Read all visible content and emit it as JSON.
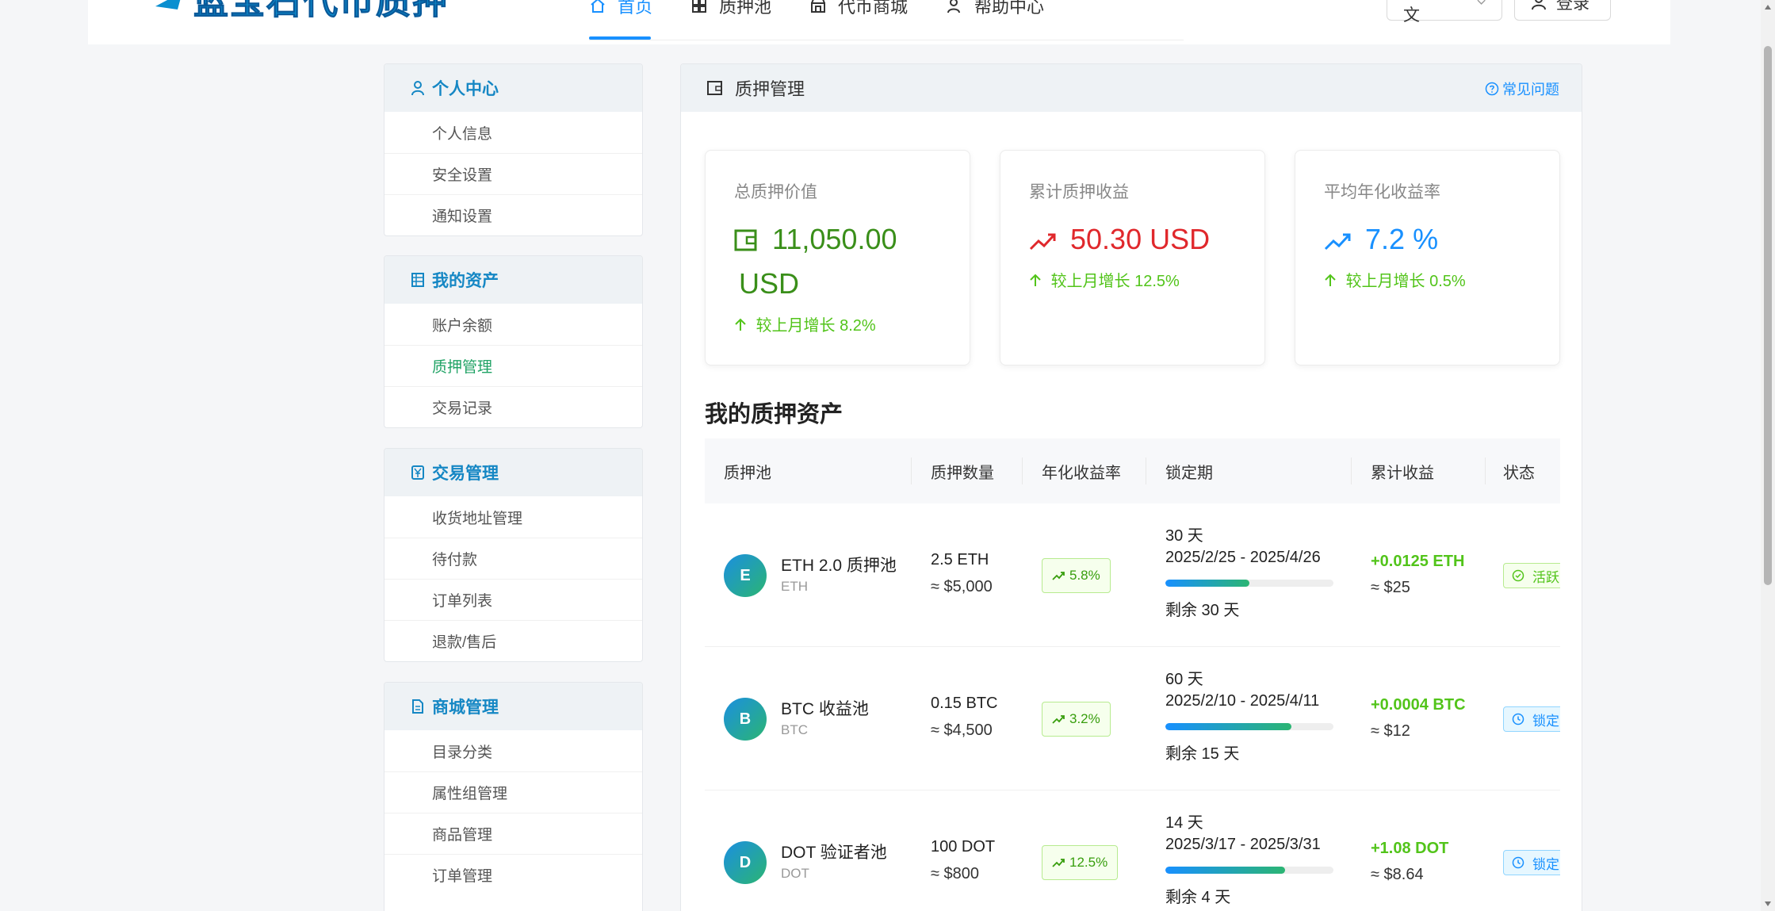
{
  "header": {
    "logo_text": "蓝宝石代币质押",
    "nav": [
      {
        "label": "首页",
        "icon": "home-icon",
        "active": true
      },
      {
        "label": "质押池",
        "icon": "grid-icon",
        "active": false
      },
      {
        "label": "代币商城",
        "icon": "shop-icon",
        "active": false
      },
      {
        "label": "帮助中心",
        "icon": "help-user-icon",
        "active": false
      }
    ],
    "lang_label": "简体中文",
    "login_label": "登录"
  },
  "sidebar": {
    "groups": [
      {
        "title": "个人中心",
        "icon": "user-icon",
        "items": [
          "个人信息",
          "安全设置",
          "通知设置"
        ]
      },
      {
        "title": "我的资产",
        "icon": "ledger-icon",
        "items": [
          "账户余额",
          "质押管理",
          "交易记录"
        ],
        "active_item": "质押管理"
      },
      {
        "title": "交易管理",
        "icon": "yen-icon",
        "items": [
          "收货地址管理",
          "待付款",
          "订单列表",
          "退款/售后"
        ]
      },
      {
        "title": "商城管理",
        "icon": "document-icon",
        "items": [
          "目录分类",
          "属性组管理",
          "商品管理",
          "订单管理"
        ]
      }
    ]
  },
  "main": {
    "title": "质押管理",
    "faq_label": "常见问题",
    "stats": [
      {
        "label": "总质押价值",
        "value": "11,050.00",
        "unit": "USD",
        "growth": "较上月增长 8.2%",
        "color": "#3a8f1a"
      },
      {
        "label": "累计质押收益",
        "value": "50.30",
        "unit": "USD",
        "growth": "较上月增长 12.5%",
        "color": "#e0282c"
      },
      {
        "label": "平均年化收益率",
        "value": "7.2",
        "unit": "%",
        "growth": "较上月增长 0.5%",
        "color": "#1890ff"
      }
    ],
    "section_title": "我的质押资产",
    "table": {
      "headers": [
        "质押池",
        "质押数量",
        "年化收益率",
        "锁定期",
        "累计收益",
        "状态"
      ],
      "rows": [
        {
          "letter": "E",
          "name": "ETH 2.0 质押池",
          "symbol": "ETH",
          "amount": "2.5 ETH",
          "amount_usd": "≈ $5,000",
          "apr": "5.8%",
          "lock_days": "30 天",
          "lock_range": "2025/2/25 - 2025/4/26",
          "progress": 0.5,
          "remaining": "剩余 30 天",
          "earned": "+0.0125 ETH",
          "earned_usd": "≈ $25",
          "status": "活跃",
          "status_type": "active"
        },
        {
          "letter": "B",
          "name": "BTC 收益池",
          "symbol": "BTC",
          "amount": "0.15 BTC",
          "amount_usd": "≈ $4,500",
          "apr": "3.2%",
          "lock_days": "60 天",
          "lock_range": "2025/2/10 - 2025/4/11",
          "progress": 0.75,
          "remaining": "剩余 15 天",
          "earned": "+0.0004 BTC",
          "earned_usd": "≈ $12",
          "status": "锁定",
          "status_type": "locked"
        },
        {
          "letter": "D",
          "name": "DOT 验证者池",
          "symbol": "DOT",
          "amount": "100 DOT",
          "amount_usd": "≈ $800",
          "apr": "12.5%",
          "lock_days": "14 天",
          "lock_range": "2025/3/17 - 2025/3/31",
          "progress": 0.71,
          "remaining": "剩余 4 天",
          "earned": "+1.08 DOT",
          "earned_usd": "≈ $8.64",
          "status": "锁定",
          "status_type": "locked"
        }
      ]
    }
  },
  "colors": {
    "primary": "#1890ff",
    "success": "#52c41a",
    "danger": "#e0282c",
    "sidebar_heading": "#1587c4",
    "active_sidebar": "#21a366"
  }
}
